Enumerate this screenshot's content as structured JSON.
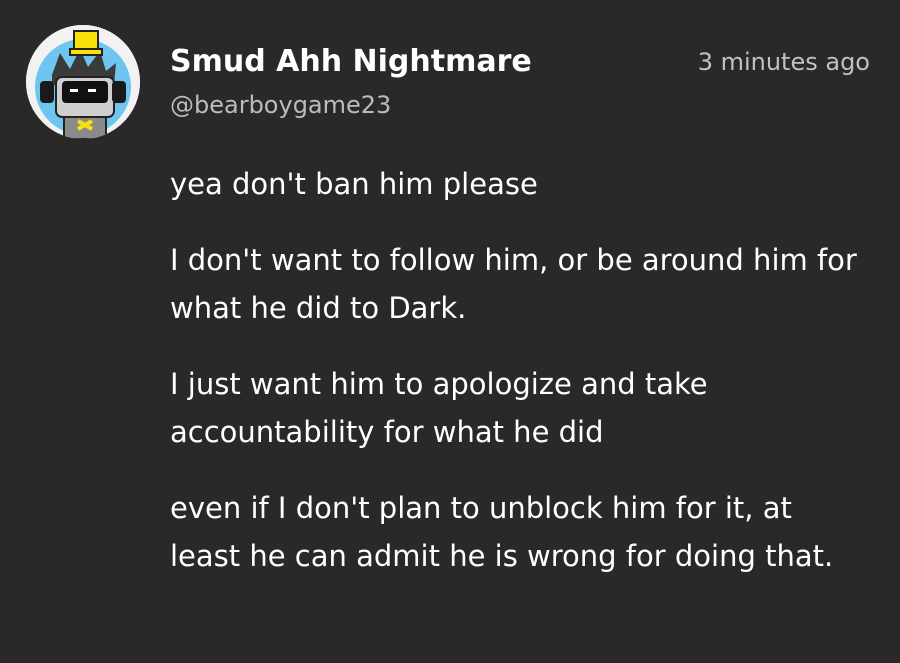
{
  "post": {
    "author": {
      "display_name": "Smud Ahh Nightmare",
      "handle": "@bearboygame23",
      "avatar_icon": "cartoon-character-avatar-icon"
    },
    "timestamp": "3 minutes ago",
    "paragraphs": [
      "yea don't ban him please",
      "I don't want to follow him, or be around him for what he did to Dark.",
      "I just want him to apologize and take accountability for what he did",
      "even if I don't plan to unblock him for it, at least he can admit he is wrong for doing that."
    ]
  },
  "colors": {
    "background": "#2b2829",
    "text": "#ffffff",
    "muted_text": "#bdbbbc",
    "avatar_sky": "#6ec6f0",
    "avatar_hat": "#f6e20a"
  }
}
